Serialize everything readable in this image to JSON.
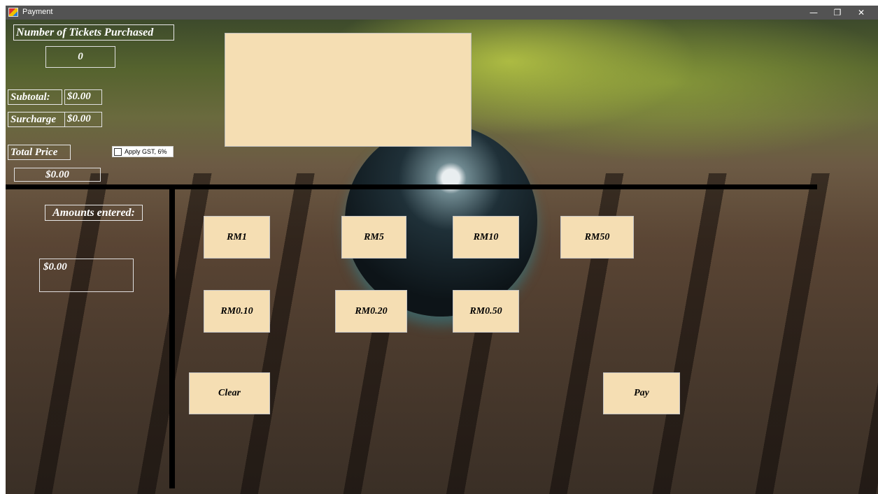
{
  "window": {
    "title": "Payment",
    "minimize_glyph": "—",
    "maximize_glyph": "❐",
    "close_glyph": "✕"
  },
  "summary": {
    "tickets_label": "Number of Tickets  Purchased",
    "tickets_value": "0",
    "subtotal_label": "Subtotal:",
    "subtotal_value": "$0.00",
    "surcharge_label": "Surcharge",
    "surcharge_value": "$0.00",
    "total_label": "Total Price",
    "total_value": "$0.00",
    "gst_label": "Apply GST, 6%",
    "gst_checked": false
  },
  "amounts": {
    "label": "Amounts entered:",
    "value": "$0.00"
  },
  "buttons": {
    "rm1": "RM1",
    "rm5": "RM5",
    "rm10": "RM10",
    "rm50": "RM50",
    "rm010": "RM0.10",
    "rm020": "RM0.20",
    "rm050": "RM0.50",
    "clear": "Clear",
    "pay": "Pay"
  },
  "colors": {
    "panel": "#f5deb3",
    "titlebar": "#535353",
    "text_light": "#ffffff"
  }
}
